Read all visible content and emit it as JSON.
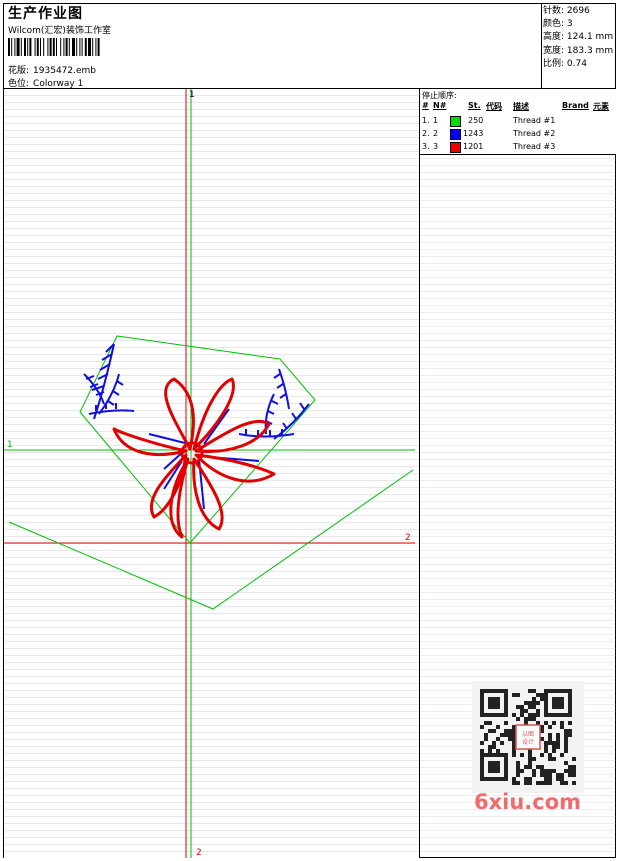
{
  "header": {
    "title": "生产作业图",
    "company": "Wilcom(汇宏)装饰工作室",
    "design_label": "花版:",
    "design_value": "1935472.emb",
    "colorway_label": "色位:",
    "colorway_value": "Colorway 1"
  },
  "stats": [
    {
      "label": "针数:",
      "value": "2696"
    },
    {
      "label": "颜色:",
      "value": "3"
    },
    {
      "label": "高度:",
      "value": "124.1 mm"
    },
    {
      "label": "宽度:",
      "value": "183.3 mm"
    },
    {
      "label": "比例:",
      "value": "0.74"
    }
  ],
  "stop_sequence": {
    "title": "停止顺序:",
    "headers": {
      "num": "#",
      "needle": "N#",
      "st": "St.",
      "code": "代码",
      "desc": "描述",
      "brand": "Brand",
      "element": "元素"
    },
    "rows": [
      {
        "num": "1.",
        "needle": "1",
        "color": "#00dd00",
        "code": "250",
        "desc": "Thread #1"
      },
      {
        "num": "2.",
        "needle": "2",
        "color": "#0000ee",
        "code": "1243",
        "desc": "Thread #2"
      },
      {
        "num": "3.",
        "needle": "3",
        "color": "#ee0000",
        "code": "1201",
        "desc": "Thread #3"
      }
    ]
  },
  "canvas": {
    "marker_top": "1",
    "marker_left": "1",
    "marker_right": "2",
    "marker_bottom": "2"
  },
  "watermark": "6xiu.com",
  "qr_badge": "以图设计"
}
